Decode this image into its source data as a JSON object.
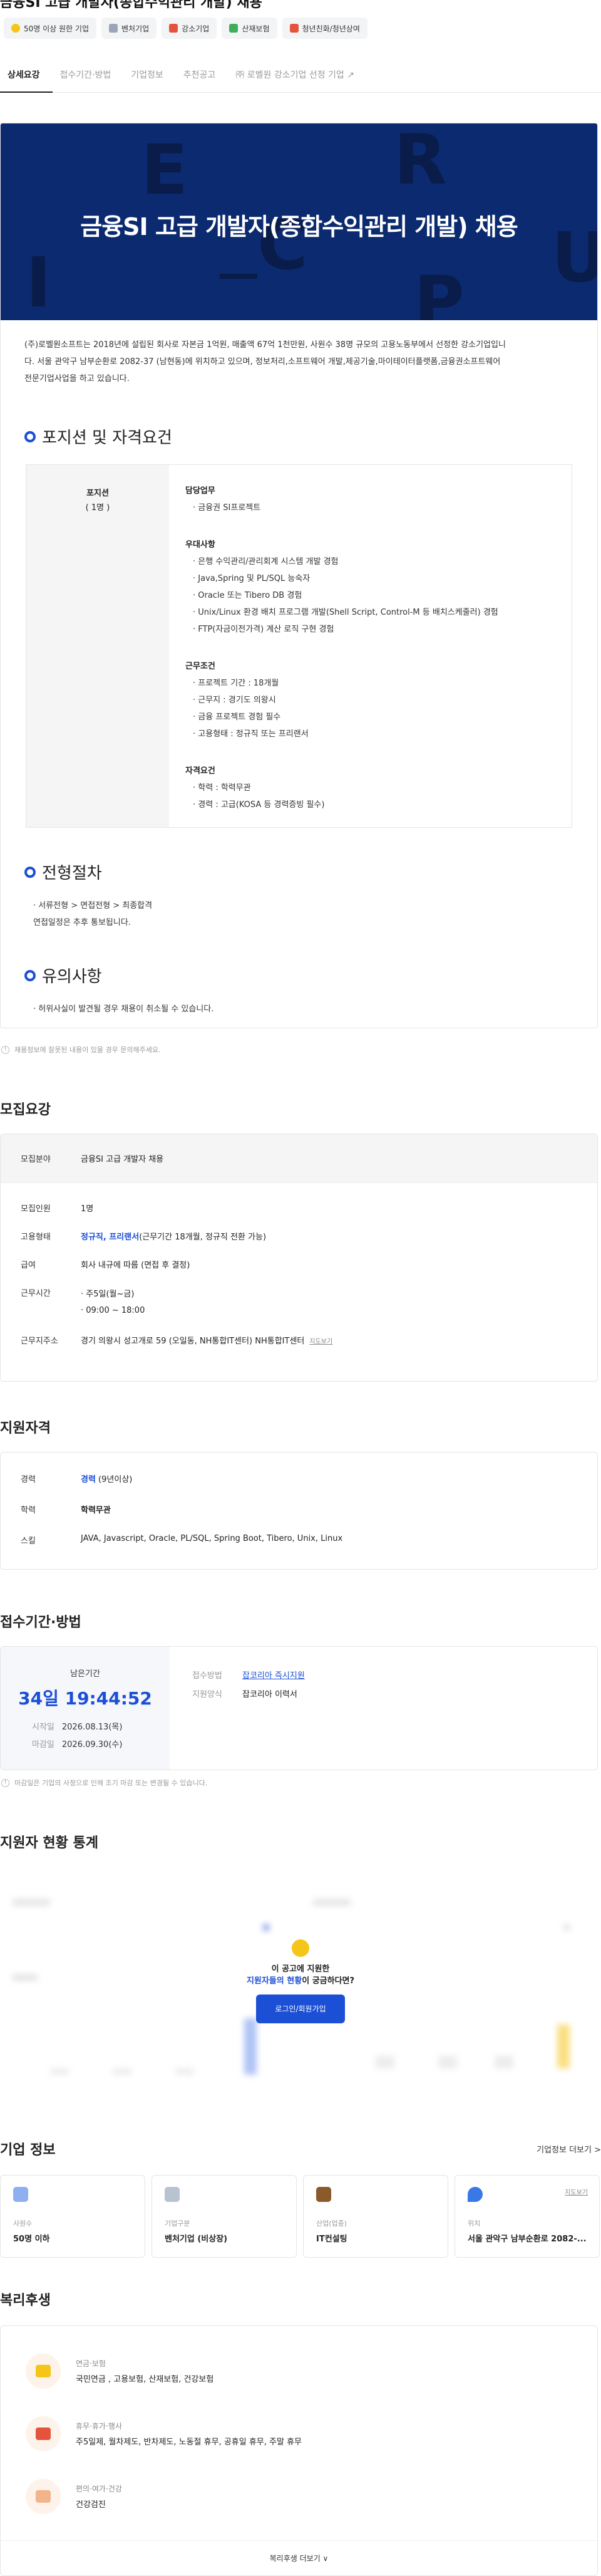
{
  "header": {
    "cut_title": "금융SI 고급 개발자(종합수익관리 개발) 채용",
    "badges": [
      {
        "label": "50명 이상 원한 기업",
        "icon": "star-icon",
        "color": "#f5c518"
      },
      {
        "label": "벤처기업",
        "icon": "building-icon",
        "color": "#9aa5b8"
      },
      {
        "label": "강소기업",
        "icon": "rocket-icon",
        "color": "#e5533d"
      },
      {
        "label": "산재보험",
        "icon": "money-icon",
        "color": "#3fae5a"
      },
      {
        "label": "청년친화/청년상여",
        "icon": "book-icon",
        "color": "#e5533d"
      }
    ]
  },
  "tabs": [
    {
      "label": "상세요강",
      "active": true
    },
    {
      "label": "접수기간·방법",
      "active": false
    },
    {
      "label": "기업정보",
      "active": false
    },
    {
      "label": "추천공고",
      "active": false
    },
    {
      "label": "㈜ 로벨원 강소기업 선정 기업 ↗",
      "active": false
    }
  ],
  "detail": {
    "banner_title": "금융SI 고급 개발자(종합수익관리 개발) 채용",
    "intro_lines": [
      "(주)로벨원소프트는 2018년에 설립된 회사로 자본금 1억원, 매출액 67억 1천만원, 사원수 38명 규모의 고용노동부에서 선정한 강소기업입니",
      "다. 서울 관악구 남부순환로 2082-37 (남현동)에 위치하고 있으며, 정보처리,소프트웨어 개발,제공기술,마이테이터플랫폼,금융권소프트웨어",
      "전문기업사업을 하고 있습니다."
    ],
    "position_heading": "포지션 및 자격요건",
    "position_name": "포지션",
    "position_count": "( 1명 )",
    "blocks": [
      {
        "title": "담당업무",
        "items": [
          "· 금융권 SI프로젝트"
        ]
      },
      {
        "title": "우대사항",
        "items": [
          "· 은행 수익관리/관리회계 시스템 개발 경험",
          "· Java,Spring 및 PL/SQL 능숙자",
          "· Oracle 또는 Tibero DB 경험",
          "· Unix/Linux 환경 배치 프로그램 개발(Shell Script, Control-M 등 배치스케줄러) 경험",
          "· FTP(자금이전가격) 계산 로직 구현 경험"
        ]
      },
      {
        "title": "근무조건",
        "items": [
          "· 프로젝트 기간 : 18개월",
          "· 근무지 : 경기도 의왕시",
          "· 금융 프로젝트 경험 필수",
          "· 고용형태 : 정규직 또는 프리랜서"
        ]
      },
      {
        "title": "자격요건",
        "items": [
          "· 학력 : 학력무관",
          "· 경력 : 고급(KOSA 등 경력증빙 필수)"
        ]
      }
    ],
    "process_heading": "전형절차",
    "process_lines": [
      "· 서류전형 > 면접전형 > 최종합격",
      "연접일정은 추후 통보됩니다."
    ],
    "caution_heading": "유의사항",
    "caution_lines": [
      "· 허위사실이 발견될 경우 채용이 취소될 수 있습니다."
    ]
  },
  "notice_text": "채용정보에 잘못된 내용이 있을 경우 문의해주세요.",
  "recruit": {
    "heading": "모집요강",
    "rows": [
      {
        "k": "모집분야",
        "v": "금융SI 고급 개발자 채용"
      },
      {
        "k": "모집인원",
        "v": "1명"
      },
      {
        "k": "고용형태",
        "v_blue": "정규직, 프리랜서",
        "v": "(근무기간 18개월, 정규직 전환 가능)"
      },
      {
        "k": "급여",
        "v": "회사 내규에 따름 (면접 후 결정)"
      },
      {
        "k": "근무시간",
        "v": "· 주5일(월~금)",
        "v2": "· 09:00 ~ 18:00"
      },
      {
        "k": "근무지주소",
        "v": "경기 의왕시 성고개로 59 (오일동, NH통합IT센터) NH통합IT센터",
        "link": "지도보기"
      }
    ]
  },
  "qualification": {
    "heading": "지원자격",
    "rows": [
      {
        "k": "경력",
        "v_blue": "경력",
        "v": " (9년이상)"
      },
      {
        "k": "학력",
        "v_blue": "학력무관",
        "v": ""
      },
      {
        "k": "스킬",
        "v": "JAVA, Javascript, Oracle, PL/SQL, Spring Boot, Tibero, Unix, Linux"
      }
    ]
  },
  "apply": {
    "heading": "접수기간·방법",
    "remaining_label": "남은기간",
    "remaining": "34일 19:44:52",
    "start_label": "시작일",
    "start": "2026.08.13(목)",
    "end_label": "마감일",
    "end": "2026.09.30(수)",
    "method_label": "접수방법",
    "method": "잡코리아 즉시지원",
    "form_label": "지원양식",
    "form": "잡코리아 이력서",
    "note": "마감일은 기업의 사정으로 인해 조기 마감 또는 변경될 수 있습니다."
  },
  "stats": {
    "heading": "지원자 현황 통계",
    "line1": "이 공고에 지원한",
    "line2_blue": "지원자들의 현황",
    "line2": "이 궁금하다면?",
    "button": "로그인/회원가입"
  },
  "company": {
    "heading": "기업 정보",
    "more": "기업정보 더보기 >",
    "cards": [
      {
        "label": "사원수",
        "value": "50명 이하",
        "icon": "people-icon",
        "color": "#8fb0f0"
      },
      {
        "label": "기업구분",
        "value": "벤처기업 (비상장)",
        "icon": "building-icon",
        "color": "#b9c2d0"
      },
      {
        "label": "산업(업종)",
        "value": "IT컨설팅",
        "icon": "briefcase-icon",
        "color": "#8a5a2b"
      },
      {
        "label": "위치",
        "value": "서울 관악구 남부순환로 2082-...",
        "icon": "pin-icon",
        "color": "#3a78e7",
        "link": "지도보기"
      }
    ]
  },
  "welfare": {
    "heading": "복리후생",
    "items": [
      {
        "category": "연금·보험",
        "items": "국민연금 , 고용보험, 산재보험, 건강보험",
        "icon": "piggy-bank-icon",
        "color": "#f5c518"
      },
      {
        "category": "휴무·휴가·행사",
        "items": "주5일제, 월차제도, 반차제도, 노동절 휴무, 공휴일 휴무, 주말 휴무",
        "icon": "party-icon",
        "color": "#e5533d"
      },
      {
        "category": "편의·여가·건강",
        "items": "건강검진",
        "icon": "muscle-icon",
        "color": "#f2b48a"
      }
    ],
    "more": "복리후생 더보기 ∨"
  }
}
